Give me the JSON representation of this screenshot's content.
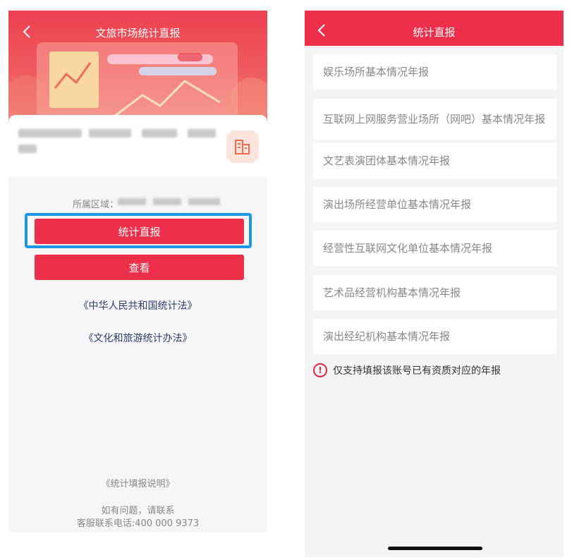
{
  "left": {
    "title": "文旅市场统计直报",
    "region_label": "所属区域：",
    "submit_button": "统计直报",
    "view_button": "查看",
    "law_link_1": "《中华人民共和国统计法》",
    "law_link_2": "《文化和旅游统计办法》",
    "instructions_link": "《统计填报说明》",
    "contact_prompt": "如有问题，请联系",
    "service_phone": "客服联系电话:400 000 9373"
  },
  "right": {
    "title": "统计直报",
    "reports": [
      "娱乐场所基本情况年报",
      "互联网上网服务营业场所（网吧）基本情况年报",
      "文艺表演团体基本情况年报",
      "演出场所经营单位基本情况年报",
      "经营性互联网文化单位基本情况年报",
      "艺术品经营机构基本情况年报",
      "演出经纪机构基本情况年报"
    ],
    "notice": "仅支持填报该账号已有资质对应的年报"
  },
  "colors": {
    "brand_red": "#ee2f4a",
    "highlight_blue": "#1e96e6",
    "link_navy": "#2c3e6b"
  }
}
